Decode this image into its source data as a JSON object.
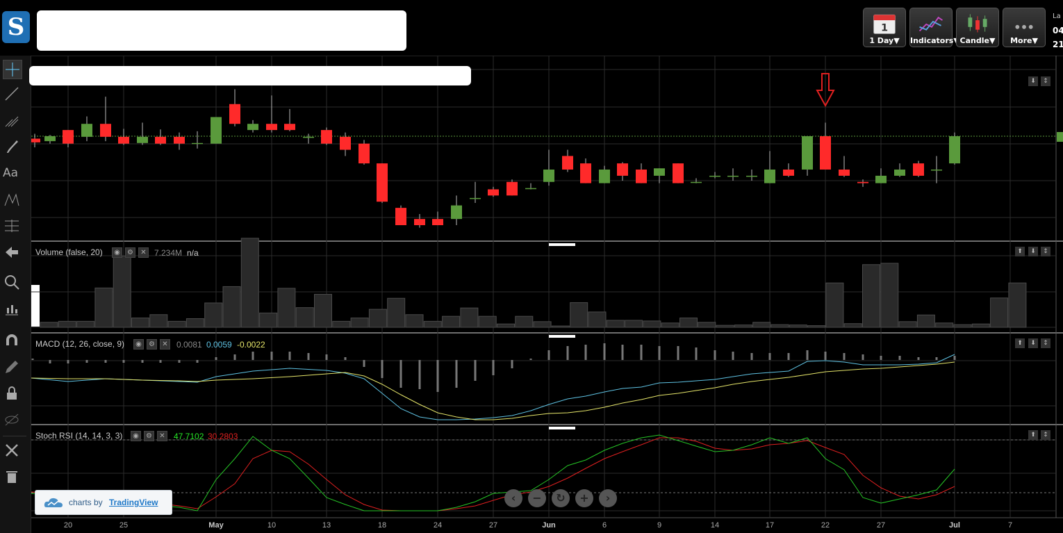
{
  "toolbar": {
    "interval_icon_text": "1",
    "interval_label": "1 Day▼",
    "indicators_label": "Indicators▼",
    "charttype_label": "Candle▼",
    "more_label": "More▼"
  },
  "right_info": {
    "line1": "La",
    "line2": "04",
    "line3": "21"
  },
  "panes": {
    "volume": {
      "title": "Volume (false, 20)",
      "value": "7.234M",
      "value2": "n/a"
    },
    "macd": {
      "title": "MACD (12, 26, close, 9)",
      "hist": "0.0081",
      "macd": "0.0059",
      "signal": "-0.0022"
    },
    "stoch": {
      "title": "Stoch RSI (14, 14, 3, 3)",
      "k": "47.7102",
      "d": "30.2803"
    }
  },
  "xaxis": [
    {
      "label": "20",
      "bold": false
    },
    {
      "label": "25",
      "bold": false
    },
    {
      "label": "May",
      "bold": true
    },
    {
      "label": "10",
      "bold": false
    },
    {
      "label": "13",
      "bold": false
    },
    {
      "label": "18",
      "bold": false
    },
    {
      "label": "24",
      "bold": false
    },
    {
      "label": "27",
      "bold": false
    },
    {
      "label": "Jun",
      "bold": true
    },
    {
      "label": "6",
      "bold": false
    },
    {
      "label": "9",
      "bold": false
    },
    {
      "label": "14",
      "bold": false
    },
    {
      "label": "17",
      "bold": false
    },
    {
      "label": "22",
      "bold": false
    },
    {
      "label": "27",
      "bold": false
    },
    {
      "label": "Jul",
      "bold": true
    },
    {
      "label": "7",
      "bold": false
    }
  ],
  "badge": {
    "prefix": "charts by",
    "brand": "TradingView"
  },
  "colors": {
    "up": "#5a9a3c",
    "down": "#ff2a2a",
    "macd": "#5fc3e4",
    "signal": "#e6e66a",
    "stoch_k": "#26c626",
    "stoch_d": "#e02020",
    "annotation_arrow": "#e02020"
  },
  "chart_data": [
    {
      "type": "candlestick",
      "title": "",
      "note": "price axis labels cut off at right edge",
      "candles": [
        {
          "o": 199.6,
          "h": 214,
          "l": 196,
          "c": 199.6
        },
        {
          "o": 199.6,
          "h": 206,
          "l": 197,
          "c": 196.4
        },
        {
          "o": 201.4,
          "h": 208,
          "l": 197,
          "c": 190.6
        },
        {
          "o": 191.6,
          "h": 216,
          "l": 188,
          "c": 198.4
        },
        {
          "o": 211.6,
          "h": 220,
          "l": 186,
          "c": 203.2
        },
        {
          "o": 191.6,
          "h": 231,
          "l": 186,
          "c": 183.4
        },
        {
          "o": 197.4,
          "h": 210,
          "l": 193,
          "c": 191.4
        },
        {
          "o": 195.8,
          "h": 216,
          "l": 193,
          "c": 189.6
        },
        {
          "o": 195.8,
          "h": 213,
          "l": 193,
          "c": 189.8
        },
        {
          "o": 185.4,
          "h": 198,
          "l": 181,
          "c": 185.2
        },
        {
          "o": 185.4,
          "h": 212,
          "l": 183,
          "c": 196.0
        },
        {
          "o": 183.4,
          "h": 200,
          "l": 180,
          "c": 181.6
        },
        {
          "o": 179.2,
          "h": 178,
          "l": 172,
          "c": 196.0
        },
        {
          "o": 193.6,
          "h": 210,
          "l": 177,
          "c": 181.4
        },
        {
          "o": 194.4,
          "h": 221,
          "l": 181,
          "c": 194.2
        },
        {
          "o": 194.4,
          "h": 197,
          "l": 188,
          "c": 189.6
        },
        {
          "o": 203.0,
          "h": 195,
          "l": 184,
          "c": 203.0
        },
        {
          "o": 178.0,
          "h": 199,
          "l": 176,
          "c": 182.8
        },
        {
          "o": 179.2,
          "h": 184,
          "l": 173,
          "c": 174.0
        }
      ]
    },
    {
      "type": "bar",
      "title": "Volume (false, 20)",
      "values": [
        0.15,
        0.18,
        0.18,
        1.18,
        2.14,
        0.28,
        0.38,
        0.18,
        0.26,
        0.73,
        1.22,
        2.67,
        0.43,
        1.17,
        0.59,
        0.99,
        0.18,
        0.28,
        0.54,
        0.87,
        0.38,
        0.18,
        0.33,
        0.58,
        0.33,
        0.1,
        0.33,
        0.17,
        0.04,
        0.74,
        0.46,
        0.21,
        0.21,
        0.19,
        0.13,
        0.28,
        0.15,
        0.06,
        0.07,
        0.15,
        0.08,
        0.07,
        0.05,
        1.33,
        0.11,
        1.88,
        1.92,
        0.17,
        0.37,
        0.13,
        0.08,
        0.1,
        0.88,
        1.33
      ]
    },
    {
      "type": "line",
      "title": "MACD (12, 26, close, 9)",
      "series": [
        {
          "name": "",
          "values": [
            0.003,
            0.0025,
            0.0028,
            0.0022,
            0.0018,
            0.0004,
            0.0065,
            0.0095,
            0.012,
            0.014,
            0.015,
            0.0135,
            0.009,
            0.0025,
            -0.018,
            -0.03,
            -0.037,
            -0.0405,
            -0.0402,
            -0.039,
            -0.0345,
            -0.0265,
            -0.0205,
            -0.017,
            -0.0135,
            -0.008,
            -0.0075,
            -0.004,
            0.0005,
            0.0045,
            0.0082,
            0.0125,
            0.0165,
            0.0185,
            0.018,
            0.017,
            0.016,
            0.017,
            0.0165,
            0.02,
            0.015,
            0.012
          ]
        },
        {
          "name": "",
          "values": [
            0.0035,
            0.0031,
            0.0032,
            0.0028,
            0.0025,
            0.002,
            0.0028,
            0.0045,
            0.0065,
            0.0085,
            0.0105,
            0.013,
            0.0128,
            0.0088,
            0.0012,
            -0.0086,
            -0.0175,
            -0.0252,
            -0.0306,
            -0.036,
            -0.037,
            -0.0356,
            -0.0315,
            -0.0275,
            -0.0232,
            -0.019,
            -0.0155,
            -0.011,
            -0.0072,
            -0.0036,
            -0.0014,
            0.0024,
            0.0065,
            0.0097,
            0.0125,
            0.0145,
            0.0155,
            0.017,
            0.018,
            0.0185,
            0.0165,
            0.015
          ]
        }
      ]
    },
    {
      "type": "line",
      "title": "Stoch RSI (14, 14, 3, 3)",
      "series": [
        {
          "name": "",
          "values": [
            22,
            20,
            17,
            8,
            2,
            33,
            53,
            80,
            67,
            59,
            40,
            10,
            0,
            0,
            0,
            0,
            8,
            23,
            28,
            44,
            54,
            64,
            70,
            79,
            80,
            74,
            68,
            64,
            67,
            80,
            70,
            80,
            58,
            45,
            13,
            9,
            13,
            24,
            48
          ]
        },
        {
          "name": "",
          "values": [
            24,
            22,
            20,
            13,
            9,
            18,
            33,
            62,
            68,
            68,
            52,
            28,
            8,
            0,
            0,
            0,
            2,
            16,
            22,
            32,
            44,
            56,
            64,
            74,
            80,
            78,
            72,
            66,
            64,
            70,
            71,
            79,
            70,
            61,
            38,
            19,
            12,
            14,
            30
          ]
        }
      ]
    }
  ]
}
